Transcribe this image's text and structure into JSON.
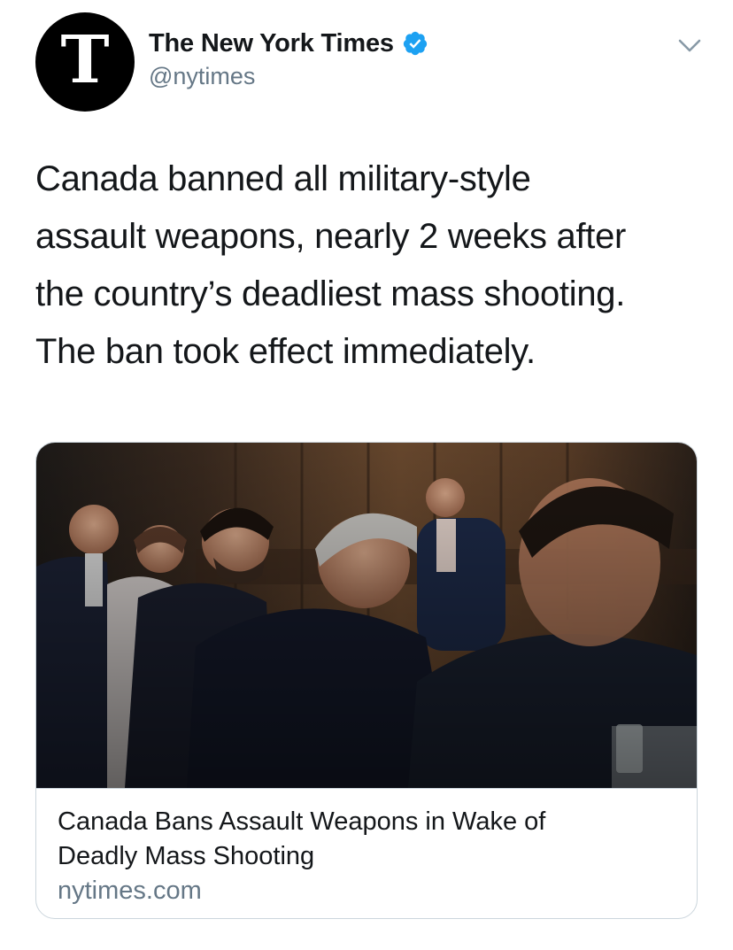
{
  "tweet": {
    "author": {
      "display_name": "The New York Times",
      "handle": "@nytimes",
      "avatar_glyph": "T",
      "avatar_icon": "nyt-logo-icon",
      "verified": true,
      "verified_icon": "verified-badge-icon"
    },
    "menu_icon": "chevron-down-icon",
    "text": "Canada banned all military-style\nassault weapons, nearly 2 weeks after\nthe country’s deadliest mass shooting.\nThe ban took effect immediately.",
    "link_card": {
      "image": "photo-of-officials-seated-at-hearing-table",
      "title": "Canada Bans Assault Weapons in Wake of Deadly Mass Shooting",
      "domain": "nytimes.com"
    }
  },
  "colors": {
    "text_primary": "#14171a",
    "text_secondary": "#657786",
    "verified_blue": "#1da1f2",
    "card_border": "#ccd6dd",
    "avatar_bg": "#000000"
  }
}
